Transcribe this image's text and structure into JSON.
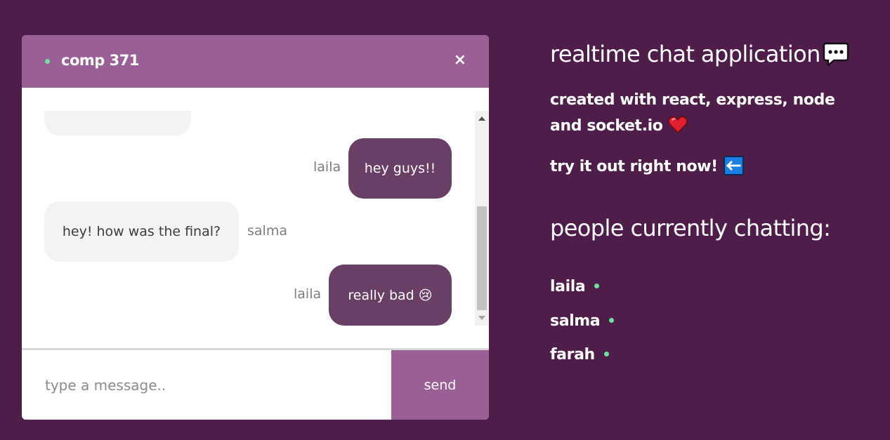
{
  "colors": {
    "online": "#6ee0a0",
    "accent": "#9a6096",
    "sent_bubble": "#693f66",
    "background": "#4f1d4a"
  },
  "chat": {
    "room_name": "comp 371",
    "close_icon": "×",
    "messages": [
      {
        "sender": "",
        "text": "",
        "direction": "received"
      },
      {
        "sender": "laila",
        "text": "hey guys!!",
        "direction": "sent"
      },
      {
        "sender": "salma",
        "text": "hey! how was the final?",
        "direction": "received"
      },
      {
        "sender": "laila",
        "text": "really bad 😢",
        "direction": "sent"
      }
    ],
    "input_placeholder": "type a message..",
    "input_value": "",
    "send_label": "send"
  },
  "info": {
    "title": "realtime chat application",
    "title_icon": "speech-bubble-icon",
    "description": "created with react, express, node and socket.io",
    "description_icon": "heart-icon",
    "try_text": "try it out right now!",
    "try_icon": "left-arrow-icon",
    "people_heading": "people currently chatting:",
    "users": [
      "laila",
      "salma",
      "farah"
    ]
  }
}
